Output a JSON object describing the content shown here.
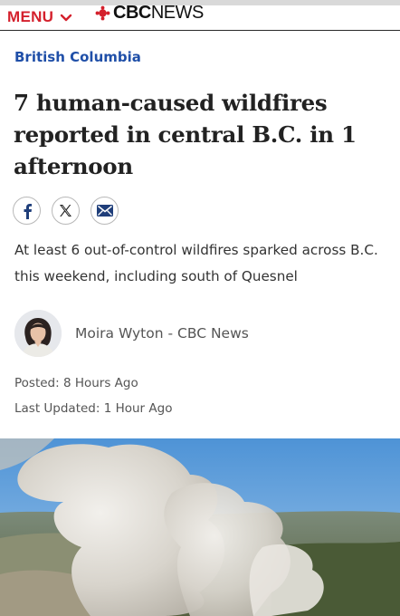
{
  "header": {
    "menu_label": "MENU",
    "logo_bold": "CBC",
    "logo_light": "NEWS"
  },
  "article": {
    "section": "British Columbia",
    "headline": "7 human-caused wildfires reported in central B.C. in 1 afternoon",
    "dek": "At least 6 out-of-control wildfires sparked across B.C. this weekend, including south of Quesnel",
    "author": "Moira Wyton - CBC News",
    "posted": "Posted: 8 Hours Ago",
    "updated": "Last Updated: 1 Hour Ago"
  },
  "share": [
    {
      "icon": "facebook-icon"
    },
    {
      "icon": "x-icon"
    },
    {
      "icon": "email-icon"
    }
  ],
  "colors": {
    "brand_red": "#d4202c",
    "section_blue": "#1f4fa8"
  }
}
